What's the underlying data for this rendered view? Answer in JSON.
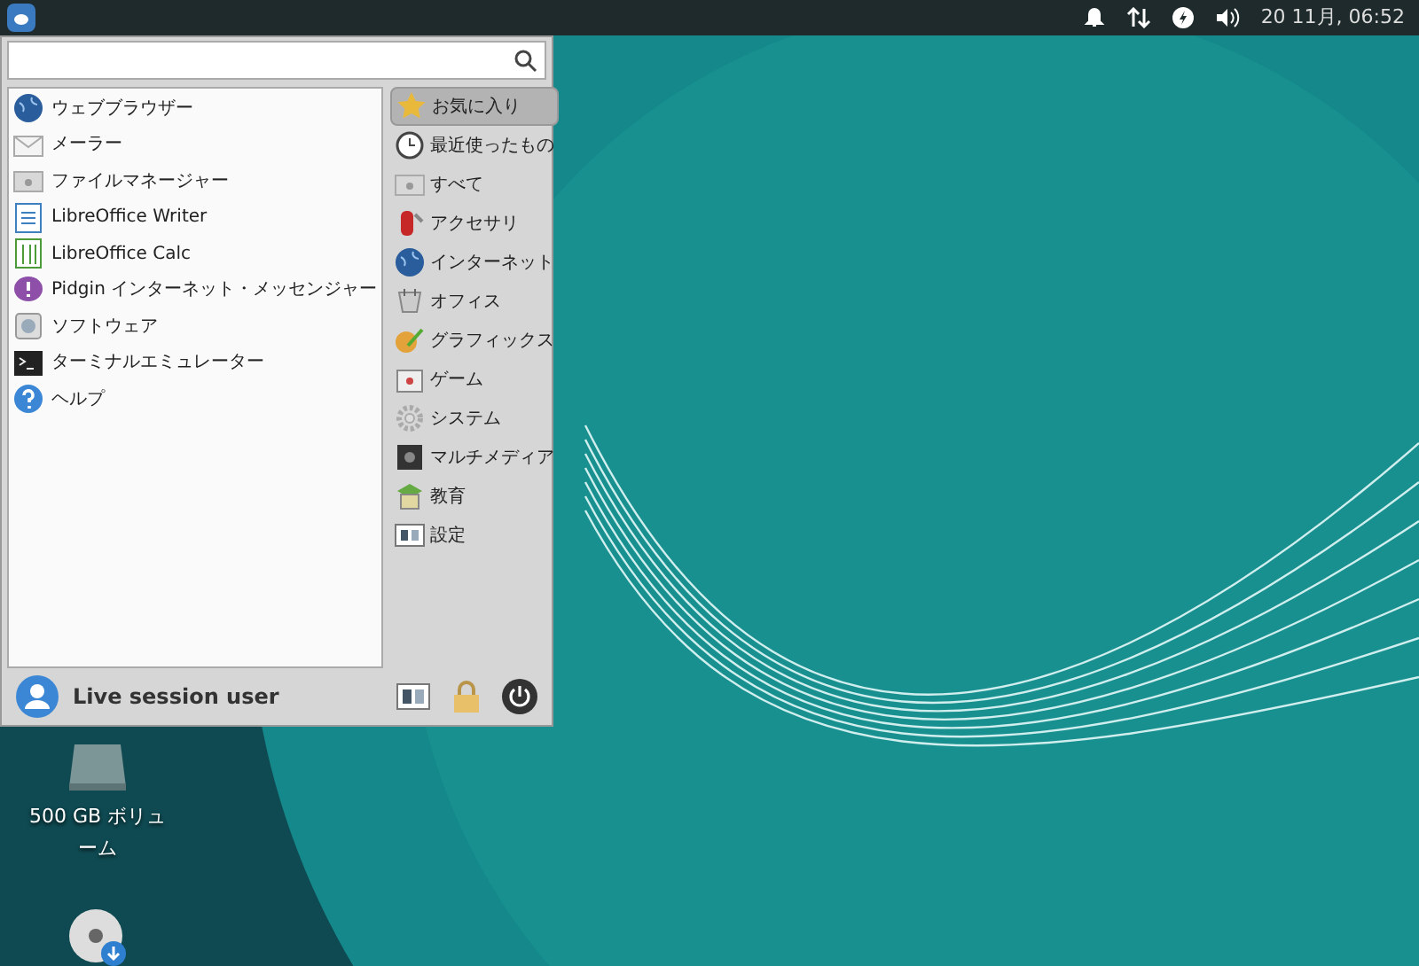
{
  "panel": {
    "clock": "20 11月, 06:52"
  },
  "menu": {
    "apps": [
      {
        "label": "ウェブブラウザー",
        "kind": "globe"
      },
      {
        "label": "メーラー",
        "kind": "mail"
      },
      {
        "label": "ファイルマネージャー",
        "kind": "folder"
      },
      {
        "label": "LibreOffice Writer",
        "kind": "writer"
      },
      {
        "label": "LibreOffice Calc",
        "kind": "calc"
      },
      {
        "label": "Pidgin インターネット・メッセンジャー",
        "kind": "chat"
      },
      {
        "label": "ソフトウェア",
        "kind": "package"
      },
      {
        "label": "ターミナルエミュレーター",
        "kind": "terminal"
      },
      {
        "label": "ヘルプ",
        "kind": "help"
      }
    ],
    "categories": [
      {
        "label": "お気に入り",
        "kind": "star",
        "selected": true
      },
      {
        "label": "最近使ったもの",
        "kind": "clock",
        "selected": false
      },
      {
        "label": "すべて",
        "kind": "folder",
        "selected": false
      },
      {
        "label": "アクセサリ",
        "kind": "tool",
        "selected": false
      },
      {
        "label": "インターネット",
        "kind": "globe",
        "selected": false
      },
      {
        "label": "オフィス",
        "kind": "office",
        "selected": false
      },
      {
        "label": "グラフィックス",
        "kind": "brush",
        "selected": false
      },
      {
        "label": "ゲーム",
        "kind": "game",
        "selected": false
      },
      {
        "label": "システム",
        "kind": "gear",
        "selected": false
      },
      {
        "label": "マルチメディア",
        "kind": "media",
        "selected": false
      },
      {
        "label": "教育",
        "kind": "edu",
        "selected": false
      },
      {
        "label": "設定",
        "kind": "settings",
        "selected": false
      }
    ],
    "user": "Live session user"
  },
  "desktop_icons": [
    {
      "label": "500 GB ボリューム",
      "kind": "drive"
    },
    {
      "kind": "disc"
    }
  ]
}
